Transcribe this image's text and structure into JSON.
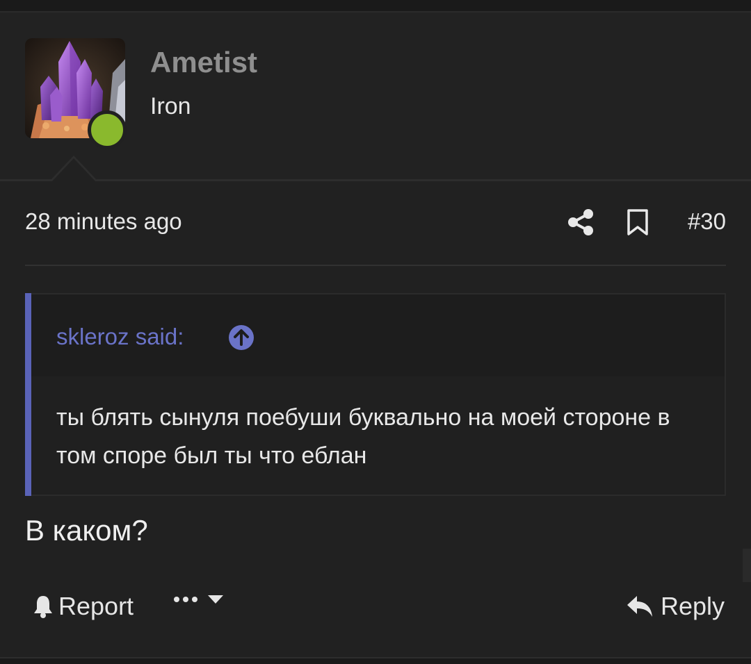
{
  "user": {
    "name": "Ametist",
    "title": "Iron",
    "online": true,
    "avatar_icon": "amethyst-crystal-avatar"
  },
  "post": {
    "timestamp": "28 minutes ago",
    "number": "#30",
    "message": "В каком?"
  },
  "quote": {
    "author_label": "skleroz said:",
    "body": "ты блять сынуля поебуши буквально на моей стороне в том споре был ты что еблан"
  },
  "actions": {
    "report_label": "Report",
    "reply_label": "Reply",
    "more_icon": "ellipsis-icon"
  },
  "colors": {
    "background": "#212121",
    "online": "#8ab92d",
    "quote_accent": "#5a63b8",
    "quote_author": "#6a73c8",
    "username": "#8f8f8f"
  }
}
